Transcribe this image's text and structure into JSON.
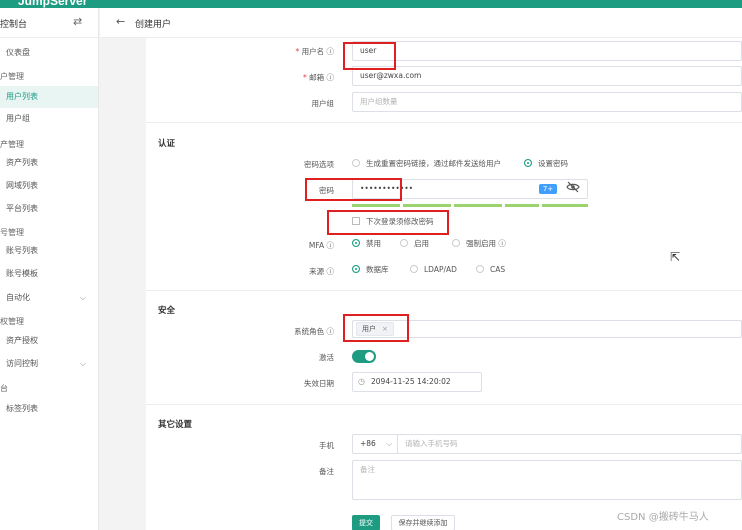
{
  "app": {
    "logo": "JumpServer"
  },
  "sidebar": {
    "title": "控制台",
    "items": [
      {
        "label": "仪表盘"
      },
      {
        "label": "户管理"
      },
      {
        "label": "用户列表"
      },
      {
        "label": "用户组"
      },
      {
        "label": "产管理"
      },
      {
        "label": "资产列表"
      },
      {
        "label": "网域列表"
      },
      {
        "label": "平台列表"
      },
      {
        "label": "号管理"
      },
      {
        "label": "账号列表"
      },
      {
        "label": "账号模板"
      },
      {
        "label": "自动化"
      },
      {
        "label": "权管理"
      },
      {
        "label": "资产授权"
      },
      {
        "label": "访问控制"
      },
      {
        "label": "台"
      },
      {
        "label": "标签列表"
      }
    ]
  },
  "header": {
    "breadcrumb": "创建用户"
  },
  "form": {
    "username": {
      "label": "用户名",
      "value": "user"
    },
    "email": {
      "label": "邮箱",
      "value": "user@zwxa.com"
    },
    "group": {
      "label": "用户组",
      "placeholder": "用户组数量"
    },
    "auth_section": "认证",
    "password_option": {
      "label": "密码选项",
      "options": [
        "生成重置密码链接，通过邮件发送给用户",
        "设置密码"
      ],
      "selected": "设置密码"
    },
    "password": {
      "label": "密码",
      "value": "••••••••••••",
      "strength_badge": "7+"
    },
    "must_change": {
      "label": "下次登录须修改密码",
      "checked": false
    },
    "mfa": {
      "label": "MFA",
      "options": [
        "禁用",
        "启用",
        "强制启用"
      ],
      "selected": "禁用"
    },
    "source": {
      "label": "来源",
      "options": [
        "数据库",
        "LDAP/AD",
        "CAS"
      ],
      "selected": "数据库"
    },
    "security_section": "安全",
    "system_role": {
      "label": "系统角色",
      "tag": "用户",
      "tag_close": "×"
    },
    "active": {
      "label": "激活",
      "on": true
    },
    "expire": {
      "label": "失效日期",
      "value": "2094-11-25 14:20:02"
    },
    "other_section": "其它设置",
    "phone": {
      "label": "手机",
      "country_code": "+86",
      "placeholder": "请输入手机号码"
    },
    "remark": {
      "label": "备注",
      "placeholder": "备注"
    },
    "buttons": {
      "submit": "提交",
      "save_continue": "保存并继续添加"
    }
  },
  "watermark": "CSDN @搬砖牛马人",
  "colors": {
    "accent": "#1e9c82",
    "highlight": "#e02020"
  }
}
